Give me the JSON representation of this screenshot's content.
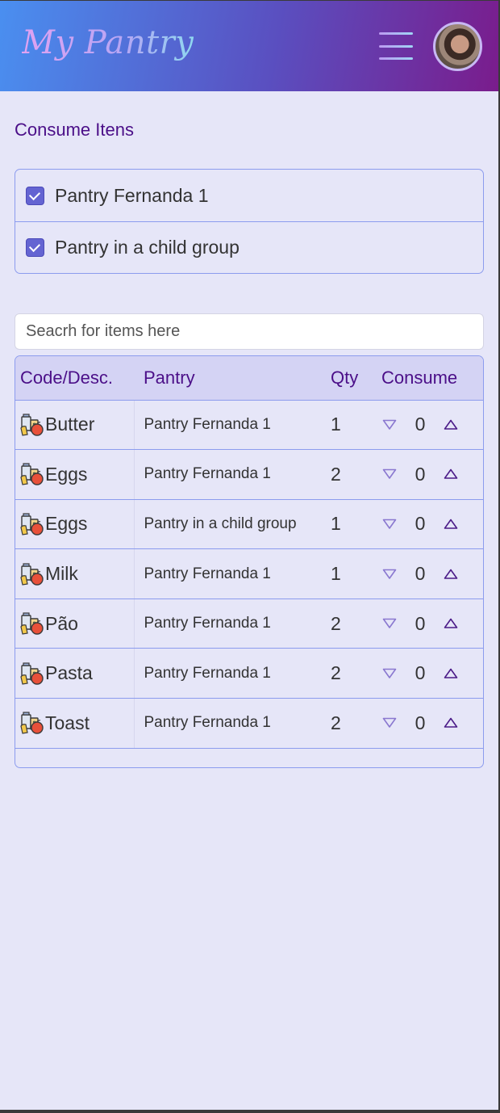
{
  "header": {
    "brand": "My Pantry",
    "menu_icon": "hamburger-menu-icon",
    "avatar": "user-avatar"
  },
  "colors": {
    "header_gradient": [
      "#4a8ff0",
      "#5a4fc0",
      "#7a1c8c"
    ],
    "title": "#4b0f88",
    "border": "#8c9cee",
    "background": "#e6e6f8",
    "checkbox": "#6464d2"
  },
  "page": {
    "title": "Consume Itens"
  },
  "pantries": [
    {
      "label": "Pantry Fernanda 1",
      "checked": true
    },
    {
      "label": "Pantry in a child group",
      "checked": true
    }
  ],
  "search": {
    "placeholder": "Seacrh for items here",
    "value": ""
  },
  "table": {
    "columns": [
      "Code/Desc.",
      "Pantry",
      "Qty",
      "Consume"
    ],
    "rows": [
      {
        "item": "Butter",
        "pantry": "Pantry Fernanda 1",
        "qty": "1",
        "consume": "0",
        "icon": "grocery-icon"
      },
      {
        "item": "Eggs",
        "pantry": "Pantry Fernanda 1",
        "qty": "2",
        "consume": "0",
        "icon": "grocery-icon"
      },
      {
        "item": "Eggs",
        "pantry": "Pantry in a child group",
        "qty": "1",
        "consume": "0",
        "icon": "grocery-icon"
      },
      {
        "item": "Milk",
        "pantry": "Pantry Fernanda 1",
        "qty": "1",
        "consume": "0",
        "icon": "grocery-icon"
      },
      {
        "item": "Pão",
        "pantry": "Pantry Fernanda 1",
        "qty": "2",
        "consume": "0",
        "icon": "grocery-icon"
      },
      {
        "item": "Pasta",
        "pantry": "Pantry Fernanda 1",
        "qty": "2",
        "consume": "0",
        "icon": "grocery-icon"
      },
      {
        "item": "Toast",
        "pantry": "Pantry Fernanda 1",
        "qty": "2",
        "consume": "0",
        "icon": "grocery-icon"
      }
    ]
  }
}
